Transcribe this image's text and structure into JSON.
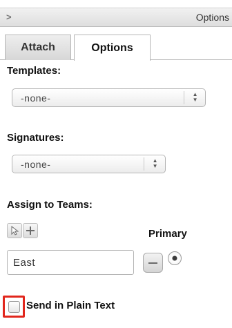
{
  "panel": {
    "title": "Options",
    "collapse_icon": "chevron-right-icon"
  },
  "tabs": [
    {
      "label": "Attach",
      "active": false
    },
    {
      "label": "Options",
      "active": true
    }
  ],
  "templates": {
    "label": "Templates:",
    "selected": "-none-"
  },
  "signatures": {
    "label": "Signatures:",
    "selected": "-none-"
  },
  "teams": {
    "label": "Assign to Teams:",
    "select_icon": "cursor-arrow-icon",
    "add_icon": "plus-icon",
    "primary_label": "Primary",
    "entries": [
      {
        "value": "East",
        "primary": true
      }
    ]
  },
  "plain_text": {
    "label": "Send in Plain Text",
    "checked": false
  }
}
